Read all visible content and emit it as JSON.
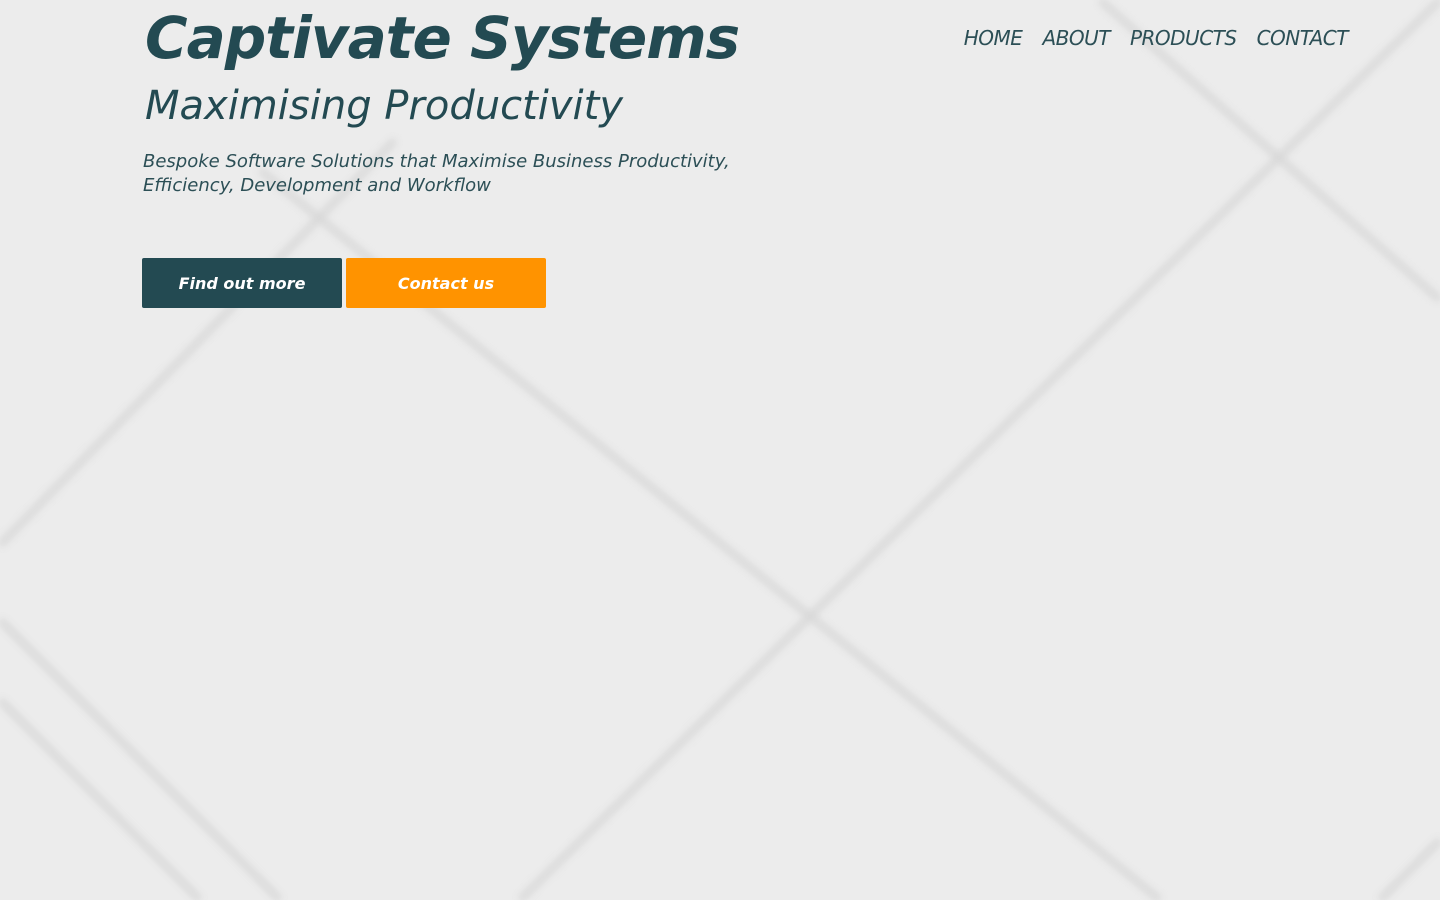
{
  "brand": {
    "title": "Captivate Systems",
    "tagline": "Maximising Productivity"
  },
  "hero": {
    "description": "Bespoke Software Solutions that Maximise Business Productivity, Efficiency, Development and Workflow"
  },
  "nav": {
    "items": [
      {
        "label": "HOME"
      },
      {
        "label": "ABOUT"
      },
      {
        "label": "PRODUCTS"
      },
      {
        "label": "CONTACT"
      }
    ]
  },
  "cta": {
    "find_out_more": "Find out more",
    "contact_us": "Contact us"
  },
  "colors": {
    "primary": "#234a52",
    "accent": "#ff9300",
    "background": "#ececec"
  }
}
